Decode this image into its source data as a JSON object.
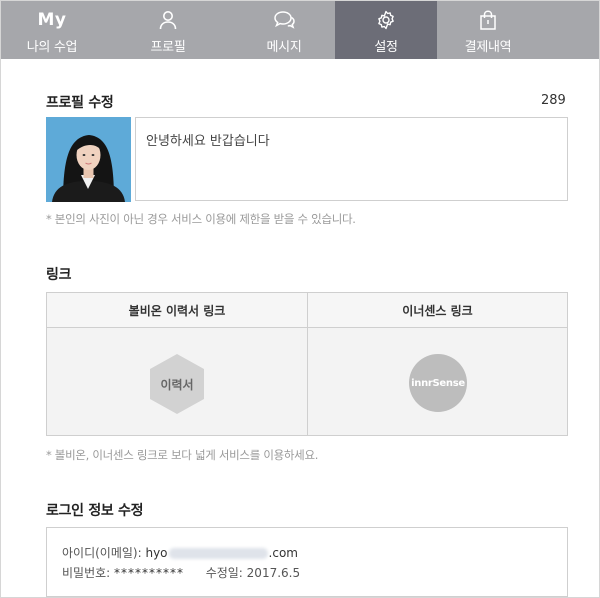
{
  "tabs": [
    {
      "id": "my-class",
      "top": "My",
      "label": "나의 수업",
      "icon": "my-text"
    },
    {
      "id": "profile",
      "label": "프로필",
      "icon": "person-icon"
    },
    {
      "id": "messages",
      "label": "메시지",
      "icon": "chat-icon"
    },
    {
      "id": "settings",
      "label": "설정",
      "icon": "gear-icon",
      "active": true
    },
    {
      "id": "payments",
      "label": "결제내역",
      "icon": "shopping-bag-icon"
    }
  ],
  "profile_edit": {
    "title": "프로필 수정",
    "char_count": "289",
    "intro_text": "안녕하세요 반갑습니다",
    "photo_note": "* 본인의 사진이 아닌 경우 서비스 이용에 제한을 받을 수 있습니다."
  },
  "links": {
    "title": "링크",
    "col1_header": "볼비온 이력서 링크",
    "col1_badge": "이력서",
    "col2_header": "이너센스 링크",
    "col2_badge": "innrSense",
    "note": "* 볼비온, 이너센스 링크로 보다 넓게 서비스를 이용하세요."
  },
  "login": {
    "title": "로그인 정보 수정",
    "id_label": "아이디(이메일): ",
    "id_prefix": "hyo",
    "id_suffix": ".com",
    "password_label": "비밀번호: ",
    "password_value": "**********",
    "modified_label": "수정일: ",
    "modified_value": "2017.6.5"
  },
  "colors": {
    "tabbar": "#a6a7ab",
    "tab_active": "#6c6d77",
    "note_text": "#9a9a9a"
  }
}
